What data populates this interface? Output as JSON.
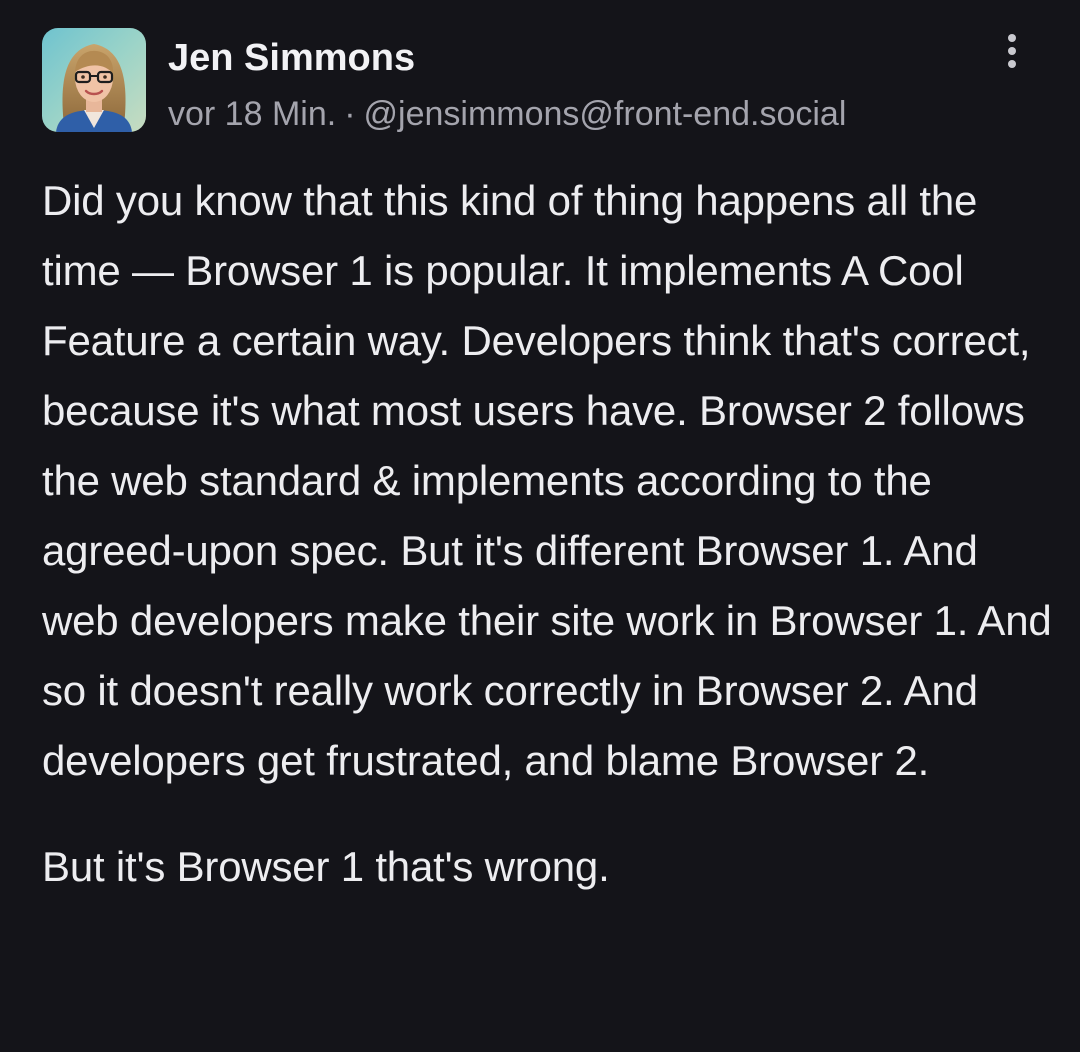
{
  "post": {
    "author": {
      "display_name": "Jen Simmons",
      "handle": "@jensimmons@front-end.social",
      "avatar_icon": "avatar-photo"
    },
    "timestamp": "vor 18 Min.",
    "separator": "·",
    "menu_icon": "more-vertical-icon",
    "paragraphs": [
      "Did you know that this kind of thing happens all the time — Browser 1 is popular. It implements A Cool Feature a certain way. Developers think that's correct, because it's what most users have. Browser 2 follows the web standard & implements according to the agreed-upon spec. But it's different Browser 1. And web developers make their site work in Browser 1. And so it doesn't really work correctly in Browser 2. And developers get frustrated, and blame Browser 2.",
      "But it's Browser 1 that's wrong."
    ]
  },
  "colors": {
    "background": "#141419",
    "text_primary": "#ededf0",
    "text_secondary": "#a4a4ad"
  }
}
